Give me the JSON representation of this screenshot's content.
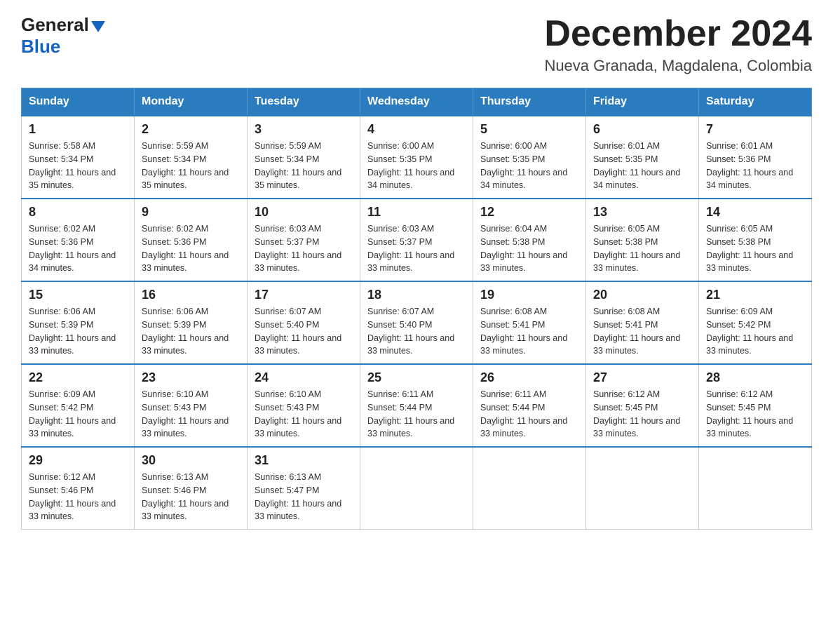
{
  "logo": {
    "general": "General",
    "blue": "Blue"
  },
  "title": "December 2024",
  "subtitle": "Nueva Granada, Magdalena, Colombia",
  "days_of_week": [
    "Sunday",
    "Monday",
    "Tuesday",
    "Wednesday",
    "Thursday",
    "Friday",
    "Saturday"
  ],
  "weeks": [
    [
      {
        "day": "1",
        "sunrise": "5:58 AM",
        "sunset": "5:34 PM",
        "daylight": "11 hours and 35 minutes."
      },
      {
        "day": "2",
        "sunrise": "5:59 AM",
        "sunset": "5:34 PM",
        "daylight": "11 hours and 35 minutes."
      },
      {
        "day": "3",
        "sunrise": "5:59 AM",
        "sunset": "5:34 PM",
        "daylight": "11 hours and 35 minutes."
      },
      {
        "day": "4",
        "sunrise": "6:00 AM",
        "sunset": "5:35 PM",
        "daylight": "11 hours and 34 minutes."
      },
      {
        "day": "5",
        "sunrise": "6:00 AM",
        "sunset": "5:35 PM",
        "daylight": "11 hours and 34 minutes."
      },
      {
        "day": "6",
        "sunrise": "6:01 AM",
        "sunset": "5:35 PM",
        "daylight": "11 hours and 34 minutes."
      },
      {
        "day": "7",
        "sunrise": "6:01 AM",
        "sunset": "5:36 PM",
        "daylight": "11 hours and 34 minutes."
      }
    ],
    [
      {
        "day": "8",
        "sunrise": "6:02 AM",
        "sunset": "5:36 PM",
        "daylight": "11 hours and 34 minutes."
      },
      {
        "day": "9",
        "sunrise": "6:02 AM",
        "sunset": "5:36 PM",
        "daylight": "11 hours and 33 minutes."
      },
      {
        "day": "10",
        "sunrise": "6:03 AM",
        "sunset": "5:37 PM",
        "daylight": "11 hours and 33 minutes."
      },
      {
        "day": "11",
        "sunrise": "6:03 AM",
        "sunset": "5:37 PM",
        "daylight": "11 hours and 33 minutes."
      },
      {
        "day": "12",
        "sunrise": "6:04 AM",
        "sunset": "5:38 PM",
        "daylight": "11 hours and 33 minutes."
      },
      {
        "day": "13",
        "sunrise": "6:05 AM",
        "sunset": "5:38 PM",
        "daylight": "11 hours and 33 minutes."
      },
      {
        "day": "14",
        "sunrise": "6:05 AM",
        "sunset": "5:38 PM",
        "daylight": "11 hours and 33 minutes."
      }
    ],
    [
      {
        "day": "15",
        "sunrise": "6:06 AM",
        "sunset": "5:39 PM",
        "daylight": "11 hours and 33 minutes."
      },
      {
        "day": "16",
        "sunrise": "6:06 AM",
        "sunset": "5:39 PM",
        "daylight": "11 hours and 33 minutes."
      },
      {
        "day": "17",
        "sunrise": "6:07 AM",
        "sunset": "5:40 PM",
        "daylight": "11 hours and 33 minutes."
      },
      {
        "day": "18",
        "sunrise": "6:07 AM",
        "sunset": "5:40 PM",
        "daylight": "11 hours and 33 minutes."
      },
      {
        "day": "19",
        "sunrise": "6:08 AM",
        "sunset": "5:41 PM",
        "daylight": "11 hours and 33 minutes."
      },
      {
        "day": "20",
        "sunrise": "6:08 AM",
        "sunset": "5:41 PM",
        "daylight": "11 hours and 33 minutes."
      },
      {
        "day": "21",
        "sunrise": "6:09 AM",
        "sunset": "5:42 PM",
        "daylight": "11 hours and 33 minutes."
      }
    ],
    [
      {
        "day": "22",
        "sunrise": "6:09 AM",
        "sunset": "5:42 PM",
        "daylight": "11 hours and 33 minutes."
      },
      {
        "day": "23",
        "sunrise": "6:10 AM",
        "sunset": "5:43 PM",
        "daylight": "11 hours and 33 minutes."
      },
      {
        "day": "24",
        "sunrise": "6:10 AM",
        "sunset": "5:43 PM",
        "daylight": "11 hours and 33 minutes."
      },
      {
        "day": "25",
        "sunrise": "6:11 AM",
        "sunset": "5:44 PM",
        "daylight": "11 hours and 33 minutes."
      },
      {
        "day": "26",
        "sunrise": "6:11 AM",
        "sunset": "5:44 PM",
        "daylight": "11 hours and 33 minutes."
      },
      {
        "day": "27",
        "sunrise": "6:12 AM",
        "sunset": "5:45 PM",
        "daylight": "11 hours and 33 minutes."
      },
      {
        "day": "28",
        "sunrise": "6:12 AM",
        "sunset": "5:45 PM",
        "daylight": "11 hours and 33 minutes."
      }
    ],
    [
      {
        "day": "29",
        "sunrise": "6:12 AM",
        "sunset": "5:46 PM",
        "daylight": "11 hours and 33 minutes."
      },
      {
        "day": "30",
        "sunrise": "6:13 AM",
        "sunset": "5:46 PM",
        "daylight": "11 hours and 33 minutes."
      },
      {
        "day": "31",
        "sunrise": "6:13 AM",
        "sunset": "5:47 PM",
        "daylight": "11 hours and 33 minutes."
      },
      null,
      null,
      null,
      null
    ]
  ],
  "labels": {
    "sunrise_prefix": "Sunrise: ",
    "sunset_prefix": "Sunset: ",
    "daylight_prefix": "Daylight: "
  }
}
